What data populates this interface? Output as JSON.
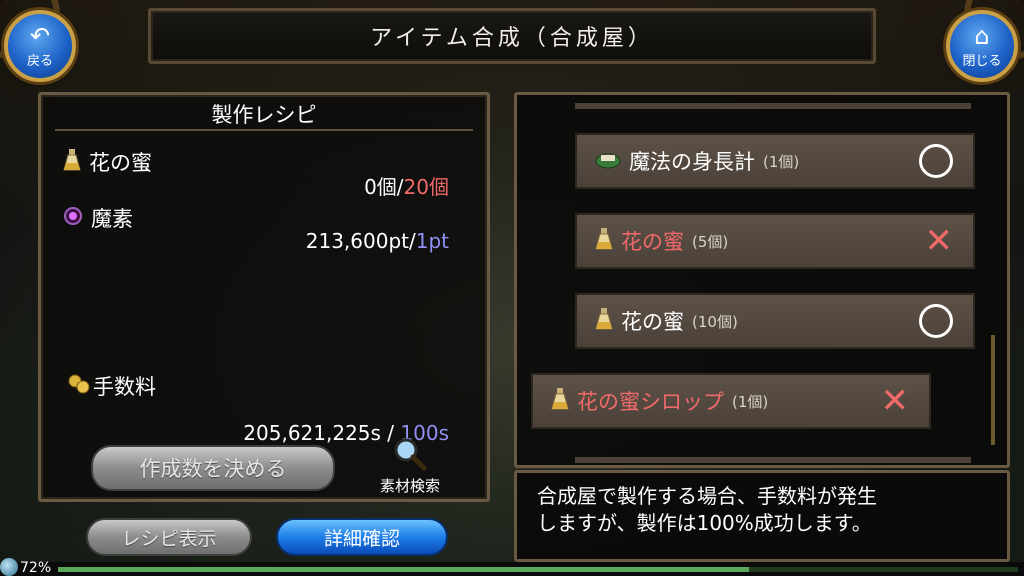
{
  "header": {
    "title": "アイテム合成（合成屋）",
    "back_label": "戻る",
    "close_label": "閉じる"
  },
  "recipe": {
    "title": "製作レシピ",
    "materials": [
      {
        "name": "花の蜜",
        "icon": "potion-icon",
        "owned": "0個/",
        "required": "20個"
      },
      {
        "name": "魔素",
        "icon": "magic-orb-icon",
        "owned": "213,600pt/",
        "required": "1pt"
      }
    ],
    "fee": {
      "label": "手数料",
      "icon": "coins-icon",
      "owned": "205,621,225s",
      "separator": " / ",
      "required": "100s"
    },
    "decide_count_button": "作成数を決める",
    "material_search_label": "素材検索"
  },
  "bottom_buttons": {
    "recipe_display": "レシピ表示",
    "details_check": "詳細確認"
  },
  "item_list": [
    {
      "name": "魔法の身長計",
      "qty": "(1個)",
      "icon": "ruler-box-icon",
      "status": "ok",
      "name_color": "white"
    },
    {
      "name": "花の蜜",
      "qty": "(5個)",
      "icon": "potion-icon",
      "status": "ng",
      "name_color": "red"
    },
    {
      "name": "花の蜜",
      "qty": "(10個)",
      "icon": "potion-icon",
      "status": "ok",
      "name_color": "white"
    },
    {
      "name": "花の蜜シロップ",
      "qty": "(1個)",
      "icon": "potion-icon",
      "status": "ng",
      "name_color": "red",
      "selected": true
    }
  ],
  "message": {
    "line1": "合成屋で製作する場合、手数料が発生",
    "line2": "しますが、製作は100%成功します。"
  },
  "status_bar": {
    "percent": "72%",
    "progress": 0.72
  },
  "colors": {
    "accent_red": "#f06a6a",
    "accent_blue": "#8f8ff5",
    "button_blue": "#1f7ee8"
  }
}
